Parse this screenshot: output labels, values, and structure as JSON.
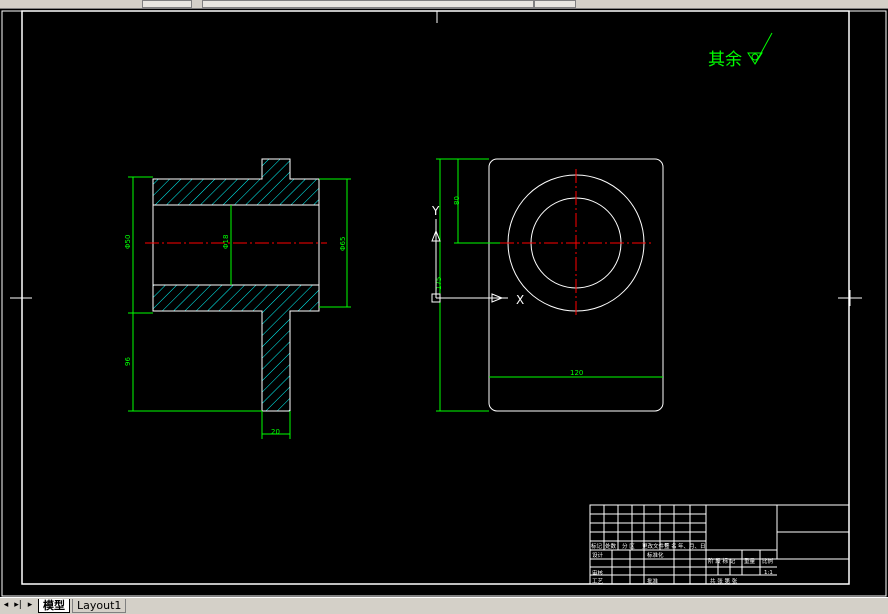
{
  "drawing": {
    "roughness_note": "其余",
    "dim_bore_dia": "Φ50",
    "dim_inner_dia": "Φ18",
    "dim_flange_dia": "Φ65",
    "dim_flange_height": "96",
    "dim_flange_thickness": "20",
    "dim_hole_center_height": "80",
    "dim_height": "175",
    "dim_width": "120",
    "ucs_y": "Y",
    "ucs_x": "X"
  },
  "title_block": {
    "row1": [
      "标记",
      "处数",
      "分 区",
      "更改文件号",
      "签 名",
      "年、月、日"
    ],
    "design": "设计",
    "standardize": "标准化",
    "stage_label": "阶 段 标 记",
    "weight_label": "重量",
    "scale_label": "比例",
    "scale_value": "1:1",
    "review": "审核",
    "process": "工艺",
    "approve": "批准",
    "sheets": "共  张  第  张"
  },
  "statusbar": {
    "tabs": [
      "模型",
      "Layout1"
    ]
  },
  "colors": {
    "background": "#000000",
    "outline": "#ffffff",
    "dimension": "#00ff00",
    "centerline": "#ff0000",
    "hatch": "#00ffff"
  }
}
